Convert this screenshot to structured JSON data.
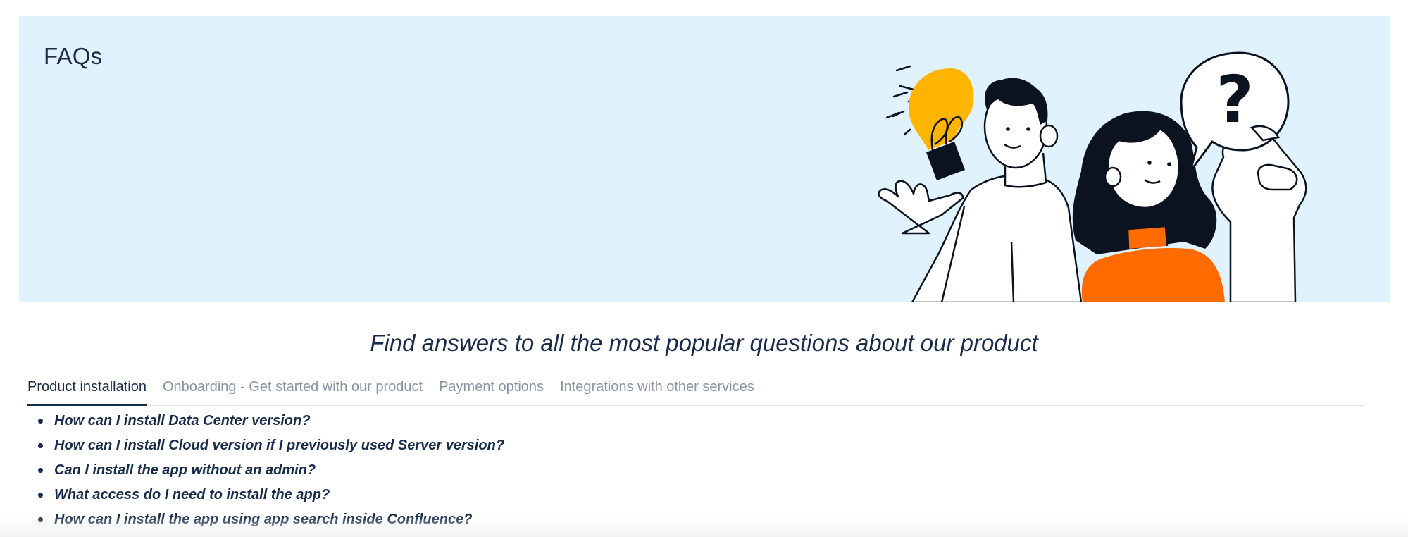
{
  "hero": {
    "title": "FAQs",
    "background_color": "#e0f2fe",
    "illustration": {
      "name": "people-with-lightbulb-and-question-illustration",
      "bulb_color": "#ffb400",
      "shirt_color": "#ff6b00"
    }
  },
  "tagline": "Find answers to all the most popular questions about our product",
  "tabs": [
    {
      "label": "Product installation",
      "active": true
    },
    {
      "label": "Onboarding - Get started with our product",
      "active": false
    },
    {
      "label": "Payment options",
      "active": false
    },
    {
      "label": "Integrations with other services",
      "active": false
    }
  ],
  "faqs": [
    {
      "question": "How can I install Data Center version?"
    },
    {
      "question": "How can I install Cloud version if I previously used Server version?"
    },
    {
      "question": "Can I install the app without an admin?"
    },
    {
      "question": "What access do I need to install the app?"
    },
    {
      "question": "How can I install the app using app search inside Confluence?"
    }
  ]
}
